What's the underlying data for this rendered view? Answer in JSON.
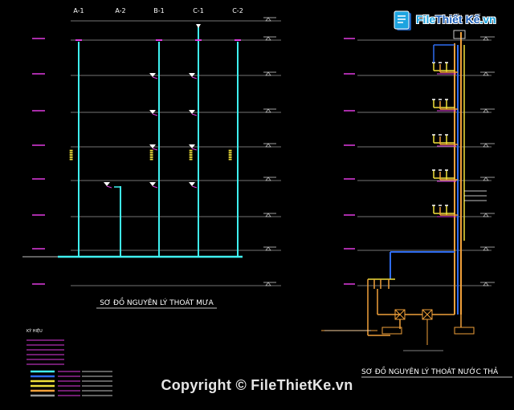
{
  "columns": [
    "A-1",
    "A-2",
    "B-1",
    "C-1",
    "C-2"
  ],
  "titles": {
    "left": "SƠ ĐỒ NGUYÊN LÝ THOÁT MƯA",
    "right": "SƠ ĐỒ NGUYÊN LÝ THOÁT NƯỚC THẢ"
  },
  "logo": {
    "part1": "File",
    "part2": "Thiết Kế",
    "part3": ".vn"
  },
  "watermark": "Copyright © FileThietKe.vn",
  "colors": {
    "level_line": "#9a9a9a",
    "rain_pipe": "#3ff0f0",
    "vent_pipe": "#2e6cf0",
    "waste_pipe": "#f0a03a",
    "yellow_pipe": "#f0e03a",
    "magenta": "#e03ae0",
    "label_green": "#3ae07a"
  },
  "legend": {
    "title": "KÝ HIỆU"
  }
}
